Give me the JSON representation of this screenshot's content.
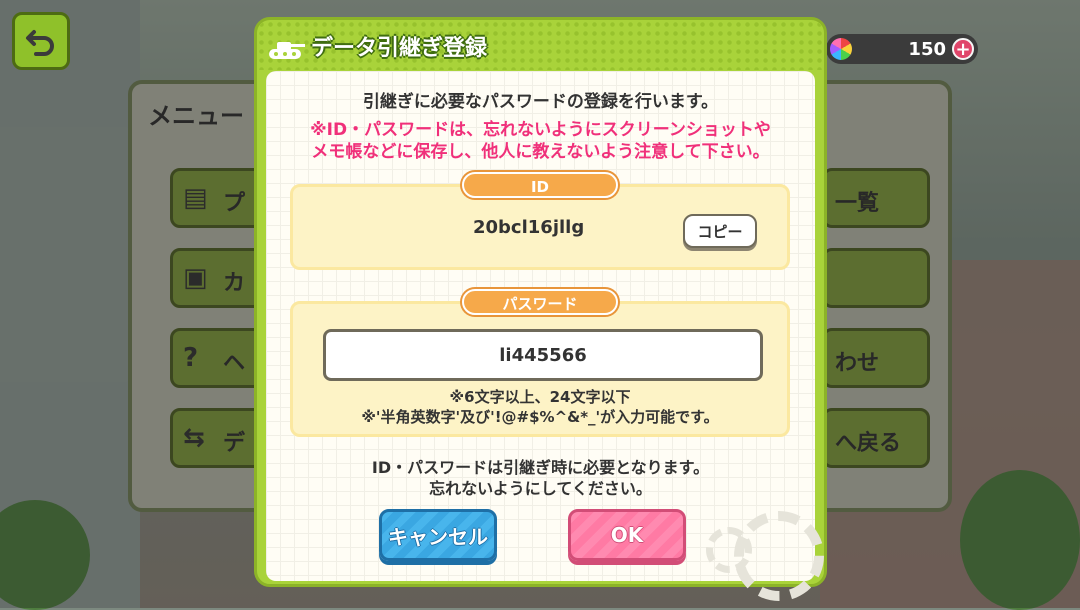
{
  "hud": {
    "currency_amount": "150",
    "currency_plus": "+",
    "back_icon": "undo-arrow-icon"
  },
  "menu": {
    "title": "メニュー",
    "left_buttons": [
      {
        "icon": "profile-card-icon",
        "label": "プ"
      },
      {
        "icon": "notebook-icon",
        "label": "カ"
      },
      {
        "icon": "question-icon",
        "label": "ヘ"
      },
      {
        "icon": "transfer-icon",
        "label": "デ"
      }
    ],
    "right_buttons": [
      {
        "label": "一覧"
      },
      {
        "label": ""
      },
      {
        "label": "わせ"
      },
      {
        "label": "へ戻る"
      }
    ]
  },
  "dialog": {
    "title": "データ引継ぎ登録",
    "intro": "引継ぎに必要なパスワードの登録を行います。",
    "warning_lines": [
      "※ID・パスワードは、忘れないようにスクリーンショットや",
      "メモ帳などに保存し、他人に教えないよう注意して下さい。"
    ],
    "id_section": {
      "label": "ID",
      "value": "20bcl16jllg",
      "copy_button": "コピー"
    },
    "password_section": {
      "label": "パスワード",
      "value": "li445566",
      "notes": [
        "※6文字以上、24文字以下",
        "※'半角英数字'及び'!@#$%^&*_'が入力可能です。"
      ]
    },
    "footer_lines": [
      "ID・パスワードは引継ぎ時に必要となります。",
      "忘れないようにしてください。"
    ],
    "cancel_button": "キャンセル",
    "ok_button": "OK"
  },
  "colors": {
    "dialog_green": "#a9d33a",
    "warning_pink": "#f0307a",
    "label_orange": "#f6a94a",
    "cancel_blue": "#48b5ec",
    "ok_pink": "#ff8ab0"
  }
}
